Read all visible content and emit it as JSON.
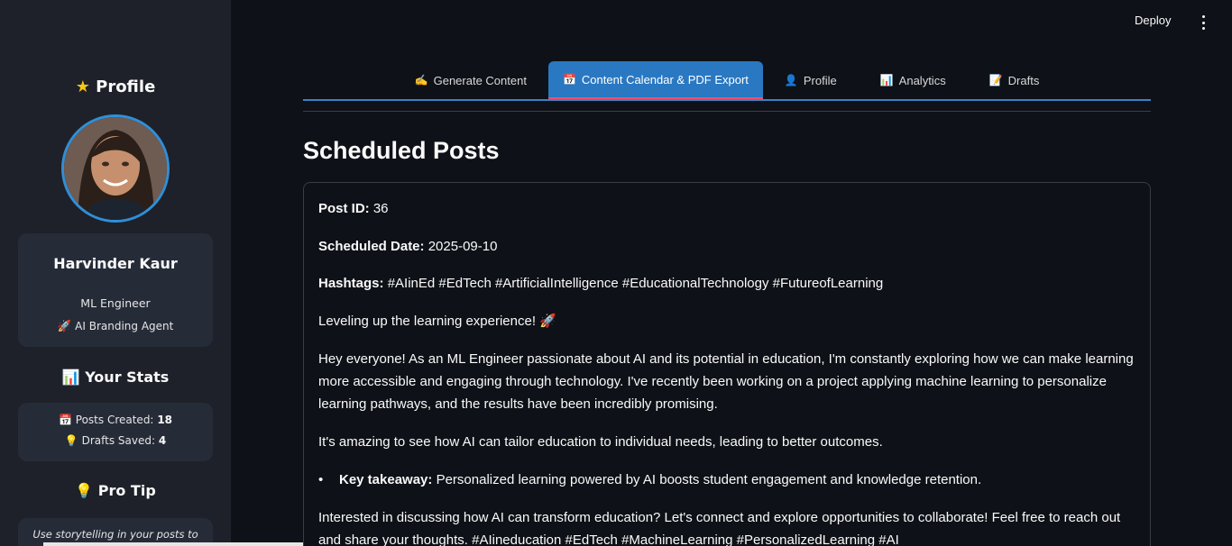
{
  "header": {
    "deploy_label": "Deploy",
    "menu_icon": "kebab-menu-icon"
  },
  "sidebar": {
    "profile_title_icon": "★",
    "profile_title": "Profile",
    "user": {
      "name": "Harvinder Kaur",
      "role": "ML Engineer",
      "agent_icon": "🚀",
      "agent": "AI Branding Agent"
    },
    "stats_title_icon": "📊",
    "stats_title": "Your Stats",
    "stats": {
      "posts_icon": "📅",
      "posts_label": "Posts Created:",
      "posts_value": "18",
      "drafts_icon": "💡",
      "drafts_label": "Drafts Saved:",
      "drafts_value": "4"
    },
    "tip_title_icon": "💡",
    "tip_title": "Pro Tip",
    "tip_text": "Use storytelling in your posts to"
  },
  "tabs": [
    {
      "icon": "✍",
      "label": "Generate Content"
    },
    {
      "icon": "📅",
      "label": "Content Calendar & PDF Export"
    },
    {
      "icon": "👤",
      "label": "Profile"
    },
    {
      "icon": "📊",
      "label": "Analytics"
    },
    {
      "icon": "📝",
      "label": "Drafts"
    }
  ],
  "active_tab": 1,
  "main": {
    "title": "Scheduled Posts",
    "post": {
      "id_label": "Post ID:",
      "id_value": "36",
      "date_label": "Scheduled Date:",
      "date_value": "2025-09-10",
      "hashtags_label": "Hashtags:",
      "hashtags_value": "#AIinEd #EdTech #ArtificialIntelligence #EducationalTechnology #FutureofLearning",
      "headline": "Leveling up the learning experience! 🚀",
      "para1_line1": "Hey everyone! As an ML Engineer passionate about AI and its potential in education, I'm constantly exploring how we can make learning",
      "para1_line2": "more accessible and engaging through technology. I've recently been working on a project applying machine learning to personalize",
      "para1_line3": "learning pathways, and the results have been incredibly promising.",
      "para2": "It's amazing to see how AI can tailor education to individual needs, leading to better outcomes.",
      "bullet_label": "Key takeaway:",
      "bullet_text": "Personalized learning powered by AI boosts student engagement and knowledge retention.",
      "para3_line1": "Interested in discussing how AI can transform education? Let's connect and explore opportunities to collaborate! Feel free to reach out",
      "para3_line2": "and share your thoughts. #AIineducation #EdTech #MachineLearning #PersonalizedLearning #AI"
    }
  },
  "colors": {
    "accent": "#2a78c2",
    "active_tab_underline": "#ff4b6b",
    "background": "#0e1117",
    "sidebar": "#1e2129"
  }
}
